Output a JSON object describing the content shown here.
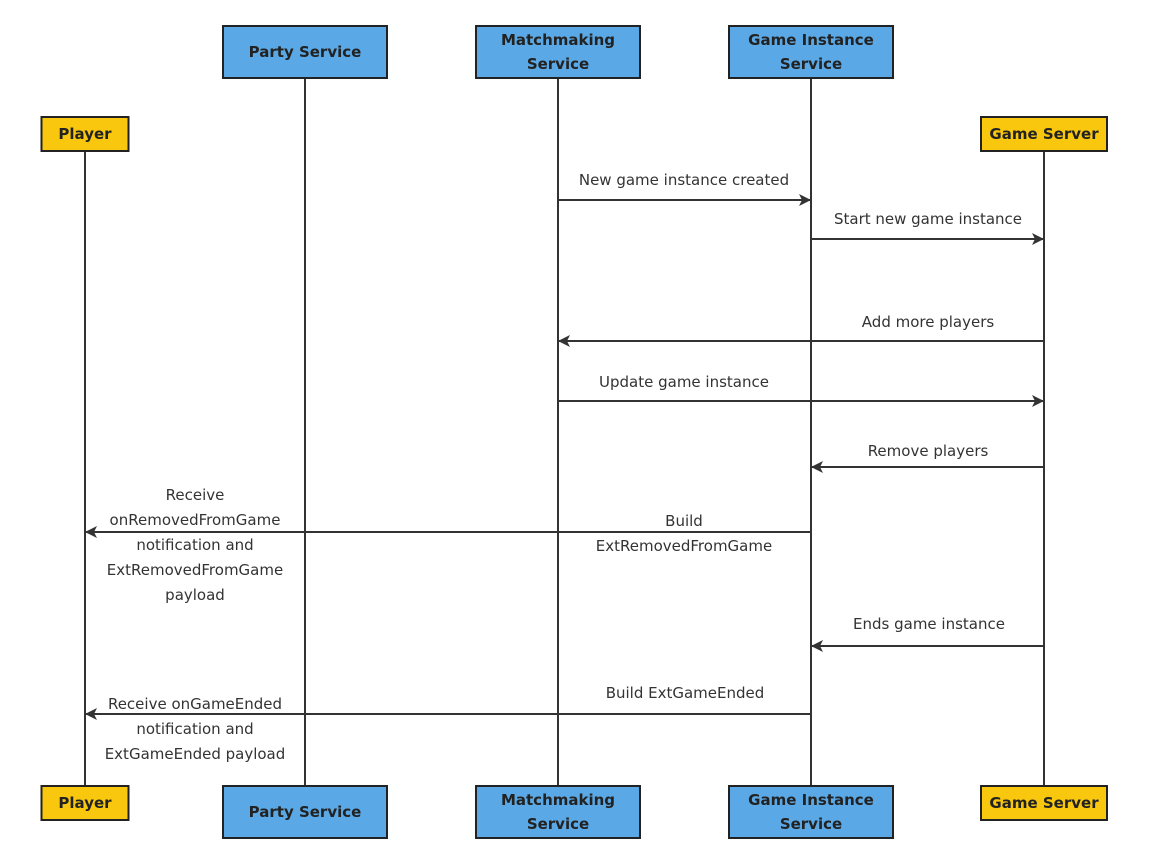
{
  "colors": {
    "service": "#5aa9e6",
    "external": "#f9c80e",
    "line": "#333333",
    "border": "#222222"
  },
  "participants": [
    {
      "id": "player",
      "lines": [
        "Player"
      ],
      "kind": "external"
    },
    {
      "id": "party",
      "lines": [
        "Party Service"
      ],
      "kind": "service"
    },
    {
      "id": "matchmaking",
      "lines": [
        "Matchmaking",
        "Service"
      ],
      "kind": "service"
    },
    {
      "id": "gameinstance",
      "lines": [
        "Game Instance",
        "Service"
      ],
      "kind": "service"
    },
    {
      "id": "gameserver",
      "lines": [
        "Game Server"
      ],
      "kind": "external"
    }
  ],
  "messages": [
    {
      "from": "matchmaking",
      "to": "gameinstance",
      "label": [
        "New game instance created"
      ]
    },
    {
      "from": "gameinstance",
      "to": "gameserver",
      "label": [
        "Start new game instance"
      ]
    },
    {
      "from": "gameserver",
      "to": "matchmaking",
      "label": [
        "Add more players"
      ]
    },
    {
      "from": "matchmaking",
      "to": "gameserver",
      "label": [
        "Update game instance"
      ]
    },
    {
      "from": "gameserver",
      "to": "gameinstance",
      "label": [
        "Remove players"
      ]
    },
    {
      "from": "gameinstance",
      "to": "player",
      "label": [
        "Build",
        "ExtRemovedFromGame"
      ],
      "target_note": [
        "Receive",
        "onRemovedFromGame",
        "notification and",
        "ExtRemovedFromGame",
        "payload"
      ]
    },
    {
      "from": "gameserver",
      "to": "gameinstance",
      "label": [
        "Ends game instance"
      ]
    },
    {
      "from": "gameinstance",
      "to": "player",
      "label": [
        "Build ExtGameEnded"
      ],
      "target_note": [
        "Receive onGameEnded",
        "notification and",
        "ExtGameEnded payload"
      ]
    }
  ]
}
